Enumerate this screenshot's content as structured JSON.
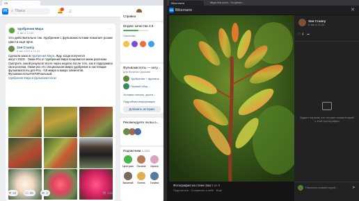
{
  "left": {
    "tab_title": "VK",
    "address": "https://vk.com/?w=...",
    "search_placeholder": "Поиск",
    "post": {
      "author": "Удобрения Мира",
      "time": "8 авг в 12:56",
      "text": "Это действительно так. Удобрение с фульвокислотами помогает розам цвести ещё ярче.",
      "repost": {
        "author": "Зоя Стаппу",
        "time": "8 авг 2023 в 21:31",
        "line1_prefix": "Сделала заказ в ",
        "line1_link": "Удобрения Мира",
        "line1_suffix": ". Жду, когда получится",
        "body": "август 2023г . Омни-Роз от Удобрения Мира понравился моим розочкам. Смотрите, какой результат всего через неделю после того, как я подкормила свои розочки. Омни-роз это специальная микро удобрение и настоящие фульвокислоты для Роз. +10 микро и макро элементов. Фульвокислоты#АКТИГиальный.",
        "link": "Удобрения Мира в фульвокислотах"
      },
      "likes": "18",
      "comments": "29",
      "shares": "3",
      "views": "132"
    },
    "right": {
      "services_title": "Справка",
      "quality_title": "Индекс качества",
      "quality_value": "3,8",
      "quality_percent": 0.62,
      "stickers_title": "Наклейки",
      "fulvo_title": "Фульвокислоты — нату...",
      "fulvo_sub": "для богатого урожая!",
      "item1": "Удобрения + фульвок...",
      "item2": "Первый сбор...",
      "item3": "Условия оплаты, доста...",
      "item4": "Подробная информация",
      "add_story": "Добавить историю",
      "recommend_title": "Рекомендуете ли вы о...",
      "subscribers_title": "Подписчики",
      "subscribers_count": "1 234",
      "subs": [
        "Центральное...",
        "Оксана",
        "Ирина",
        "Василий",
        "Елена",
        "Галина"
      ]
    }
  },
  "right": {
    "tab_title": "ВКонтакте",
    "address": "https://vk.com/...?z=photo...",
    "site": "ВКонтакте",
    "photo_caption": "Фотография на стене Зои",
    "photo_counter": "5 из 9",
    "photo_links": "Поделиться · Сохранить к себе · Ещё",
    "side": {
      "author": "Зоя Стаппу",
      "time": "8 авг в 21:31",
      "likes": "4",
      "empty_text": "Будьте первым, кто оставит комментарий к этой фотографии",
      "comment_placeholder": "Написать комментарий..."
    }
  },
  "colors": {
    "vk_blue": "#0077ff",
    "link": "#2a5885",
    "heart": "#e64646"
  }
}
